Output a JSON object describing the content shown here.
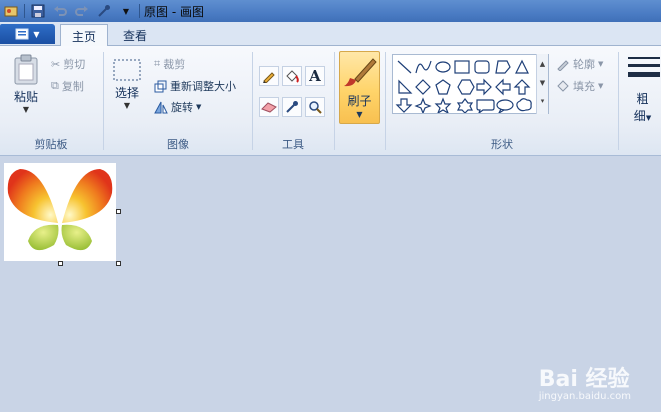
{
  "window": {
    "title": "原图 - 画图"
  },
  "tabs": [
    {
      "label": "主页",
      "active": true
    },
    {
      "label": "查看",
      "active": false
    }
  ],
  "clipboard": {
    "paste_label": "粘贴",
    "cut_label": "剪切",
    "copy_label": "复制",
    "group_label": "剪贴板"
  },
  "image": {
    "select_label": "选择",
    "crop_label": "裁剪",
    "resize_label": "重新调整大小",
    "rotate_label": "旋转",
    "group_label": "图像"
  },
  "tools": {
    "group_label": "工具"
  },
  "brushes": {
    "label": "刷子"
  },
  "shapes": {
    "outline_label": "轮廓",
    "fill_label": "填充",
    "group_label": "形状"
  },
  "size": {
    "label_line1": "粗",
    "label_line2": "细"
  },
  "watermark": {
    "brand": "Bai 经验",
    "url": "jingyan.baidu.com"
  },
  "colors": {
    "accent": "#2f6ec7",
    "brush_highlight": "#ffd46a",
    "canvas_bg": "#c9d4e6"
  }
}
